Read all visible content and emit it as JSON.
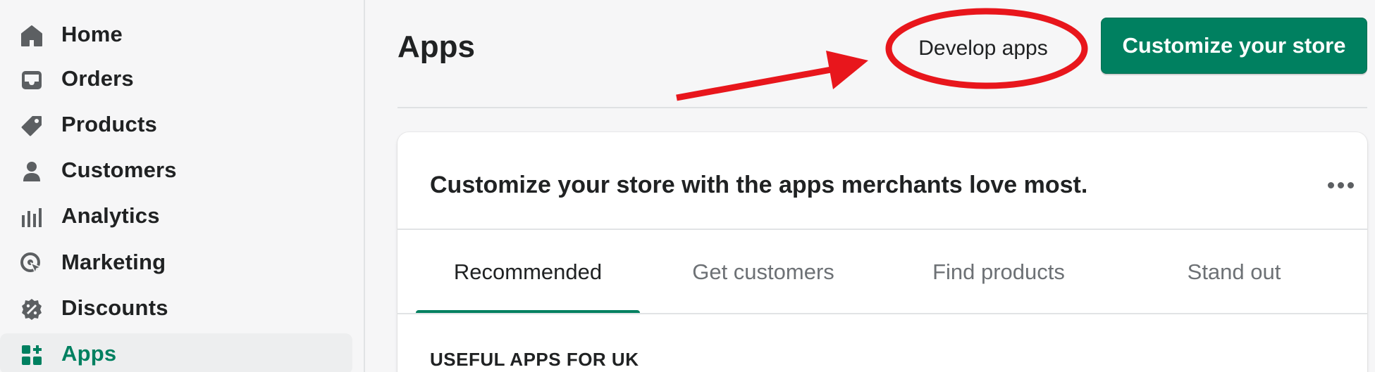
{
  "colors": {
    "accent": "#008060",
    "annotation": "#e8161c"
  },
  "sidebar": {
    "items": [
      {
        "label": "Home",
        "icon": "home-icon"
      },
      {
        "label": "Orders",
        "icon": "orders-inbox-icon"
      },
      {
        "label": "Products",
        "icon": "tag-icon"
      },
      {
        "label": "Customers",
        "icon": "person-icon"
      },
      {
        "label": "Analytics",
        "icon": "bar-chart-icon"
      },
      {
        "label": "Marketing",
        "icon": "target-icon"
      },
      {
        "label": "Discounts",
        "icon": "discount-badge-icon"
      },
      {
        "label": "Apps",
        "icon": "apps-grid-plus-icon",
        "active": true
      }
    ]
  },
  "header": {
    "title": "Apps",
    "develop_label": "Develop apps",
    "primary_label": "Customize your store"
  },
  "card": {
    "title": "Customize your store with the apps merchants love most.",
    "more_icon": "more-horizontal-icon",
    "tabs": [
      {
        "label": "Recommended",
        "active": true
      },
      {
        "label": "Get customers"
      },
      {
        "label": "Find products"
      },
      {
        "label": "Stand out"
      }
    ],
    "section_heading": "USEFUL APPS FOR UK"
  }
}
